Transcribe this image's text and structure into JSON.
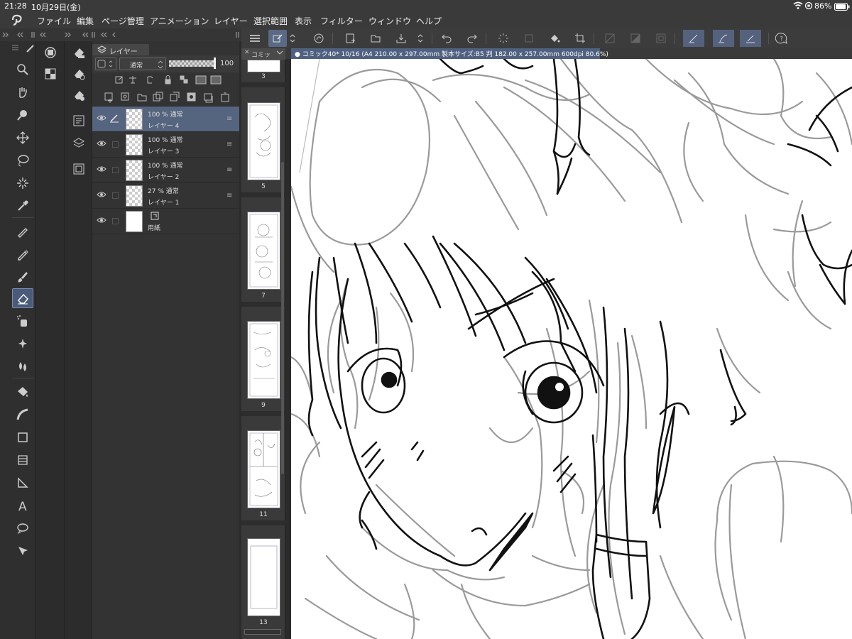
{
  "status": {
    "time": "21:28",
    "date": "10月29日(金)",
    "battery": "86%"
  },
  "menu": [
    "ファイル",
    "編集",
    "ページ管理",
    "アニメーション",
    "レイヤー",
    "選択範囲",
    "表示",
    "フィルター",
    "ウィンドウ",
    "ヘルプ"
  ],
  "layer_panel": {
    "tab": "レイヤー",
    "blend_mode": "通常",
    "opacity": "100",
    "layers": [
      {
        "line1": "100 % 通常",
        "name": "レイヤー 4",
        "selected": true
      },
      {
        "line1": "100 % 通常",
        "name": "レイヤー 3",
        "selected": false
      },
      {
        "line1": "100 % 通常",
        "name": "レイヤー 2",
        "selected": false
      },
      {
        "line1": "27 % 通常",
        "name": "レイヤー 1",
        "selected": false
      },
      {
        "line1": "",
        "name": "用紙",
        "selected": false
      }
    ]
  },
  "page_strip": {
    "tab": "コミッ",
    "pages": [
      "3",
      "5",
      "7",
      "9",
      "11",
      "13"
    ]
  },
  "canvas_tab": "コミック40* 10/16 (A4 210.00 x 297.00mm 製本サイズ:B5 判 182.00 x 257.00mm 600dpi 80.6%)"
}
